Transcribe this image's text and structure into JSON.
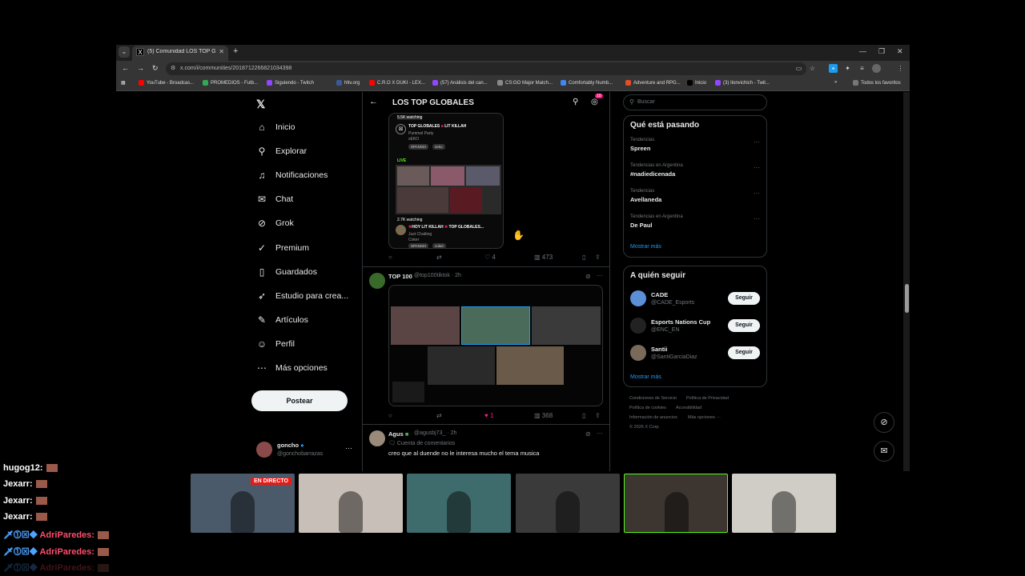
{
  "browser": {
    "tab_title": "(5) Comunidad LOS TOP GLOBA...",
    "url": "x.com/i/communities/2018712266821034398",
    "bookmarks": [
      {
        "label": "YouTube - Broadcas...",
        "color": "#ff0000"
      },
      {
        "label": "PROMEDIOS - Futb...",
        "color": "#34a853"
      },
      {
        "label": "Siguiendo - Twitch",
        "color": "#9146ff"
      },
      {
        "label": "hltv.org",
        "color": "#3b5998"
      },
      {
        "label": "C.R.O X DUKI - LEX...",
        "color": "#ff0000"
      },
      {
        "label": "(57) Análisis del can...",
        "color": "#9146ff"
      },
      {
        "label": "CS:GO Major Match...",
        "color": "#888888"
      },
      {
        "label": "Comfortably Numb...",
        "color": "#4285f4"
      },
      {
        "label": "Adventure and RPG...",
        "color": "#e44d26"
      },
      {
        "label": "Inicio",
        "color": "#000000"
      },
      {
        "label": "(3) Ilonvichich - Twit...",
        "color": "#9146ff"
      }
    ],
    "all_bookmarks": "Todos los favoritos"
  },
  "nav": {
    "items": [
      {
        "label": "Inicio",
        "icon": "home-icon",
        "glyph": "⌂"
      },
      {
        "label": "Explorar",
        "icon": "search-icon",
        "glyph": "⚲"
      },
      {
        "label": "Notificaciones",
        "icon": "bell-icon",
        "glyph": "♫"
      },
      {
        "label": "Chat",
        "icon": "mail-icon",
        "glyph": "✉"
      },
      {
        "label": "Grok",
        "icon": "grok-icon",
        "glyph": "⊘"
      },
      {
        "label": "Premium",
        "icon": "premium-icon",
        "glyph": "✓"
      },
      {
        "label": "Guardados",
        "icon": "bookmark-icon",
        "glyph": "▯"
      },
      {
        "label": "Estudio para crea...",
        "icon": "rocket-icon",
        "glyph": "➶"
      },
      {
        "label": "Artículos",
        "icon": "article-icon",
        "glyph": "✎"
      },
      {
        "label": "Perfil",
        "icon": "person-icon",
        "glyph": "☺"
      },
      {
        "label": "Más opciones",
        "icon": "more-options-icon",
        "glyph": "⋯"
      }
    ],
    "post_button": "Postear",
    "account": {
      "name": "goncho",
      "handle": "@gonchobarrazas"
    }
  },
  "community": {
    "title": "LOS TOP GLOBALES",
    "notif_count": "10"
  },
  "tweet1": {
    "watching_top": "5.5K watching",
    "stream1_title": "TOP GLOBALES",
    "stream1_title2": "LIT KILLAH",
    "stream1_game": "Pummel Party",
    "stream1_user": "sEKO",
    "stream1_tags": [
      "SPANISH",
      "seko"
    ],
    "live_label": "LIVE",
    "watching2": "2.7K watching",
    "stream2_title": "HOY LIT KILLAH",
    "stream2_title2": "TOP GLOBALES...",
    "stream2_game": "Just Chatting",
    "stream2_user": "Coker",
    "stream2_tags": [
      "SPANISH",
      "coker"
    ],
    "likes": "4",
    "views": "473"
  },
  "tweet2": {
    "name": "TOP 100",
    "handle": "@top100tiktok · 2h",
    "likes": "1",
    "views": "368"
  },
  "tweet3": {
    "name": "Agus",
    "handle": "@agusbj73_ · 2h",
    "replies_label": "Cuenta de comentarios",
    "text": "creo que al duende no le interesa mucho el tema musica"
  },
  "sidebar": {
    "search_placeholder": "Buscar",
    "trending_title": "Qué está pasando",
    "trends": [
      {
        "context": "Tendencias",
        "name": "Spreen"
      },
      {
        "context": "Tendencias en Argentina",
        "name": "#nadiedicenada"
      },
      {
        "context": "Tendencias",
        "name": "Avellaneda"
      },
      {
        "context": "Tendencias en Argentina",
        "name": "De Paul"
      }
    ],
    "show_more": "Mostrar más",
    "follow_title": "A quién seguir",
    "follows": [
      {
        "name": "CADE",
        "handle": "@CADE_Esports",
        "button": "Seguir",
        "color": "#5b8fd6"
      },
      {
        "name": "Esports Nations Cup",
        "handle": "@ENC_EN",
        "button": "Seguir",
        "color": "#222222"
      },
      {
        "name": "Santii",
        "handle": "@SantiGarciaDiaz",
        "button": "Seguir",
        "color": "#7a6a5a"
      }
    ],
    "follow_more": "Mostrar más",
    "footer": [
      "Condiciones de Servicio",
      "Política de Privacidad",
      "Política de cookies",
      "Accesibilidad",
      "Información de anuncios",
      "Más opciones ···",
      "© 2026 X Corp."
    ]
  },
  "overlay": {
    "cams": [
      {
        "color": "#4a5a6a",
        "label": "EN DIRECTO"
      },
      {
        "color": "#c8c0b8",
        "label": ""
      },
      {
        "color": "#3e6b6b",
        "label": ""
      },
      {
        "color": "#3a3a3a",
        "label": ""
      },
      {
        "color": "#3c3530",
        "label": ""
      },
      {
        "color": "#d0ccc6",
        "label": ""
      }
    ],
    "chat": [
      {
        "user": "hugog12:",
        "color": "#ffffff"
      },
      {
        "user": "Jexarr:",
        "color": "#ffffff"
      },
      {
        "user": "Jexarr:",
        "color": "#ffffff"
      },
      {
        "user": "Jexarr:",
        "color": "#ffffff"
      },
      {
        "user": "AdriParedes:",
        "color": "#ff4d6d"
      },
      {
        "user": "AdriParedes:",
        "color": "#ff4d6d"
      },
      {
        "user": "AdriParedes:",
        "color": "#ff4d6d"
      }
    ]
  }
}
